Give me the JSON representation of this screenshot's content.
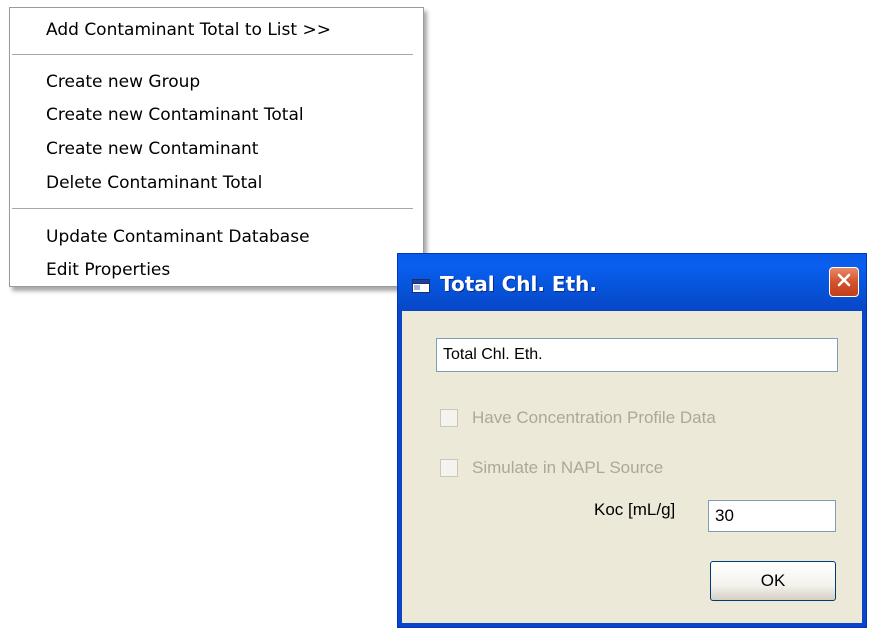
{
  "context_menu": {
    "items": [
      {
        "label": "Add Contaminant Total to List >>"
      },
      {
        "label": "Create new Group"
      },
      {
        "label": "Create new Contaminant Total"
      },
      {
        "label": "Create new Contaminant"
      },
      {
        "label": "Delete Contaminant Total"
      },
      {
        "label": "Update Contaminant Database"
      },
      {
        "label": "Edit Properties"
      }
    ]
  },
  "dialog": {
    "title": "Total Chl. Eth.",
    "title_icon": "window-icon",
    "close_icon": "close-icon",
    "name_value": "Total Chl. Eth.",
    "checkbox_concentration": {
      "label": "Have Concentration Profile Data",
      "checked": false,
      "enabled": false
    },
    "checkbox_napl": {
      "label": "Simulate in NAPL Source",
      "checked": false,
      "enabled": false
    },
    "koc_label": "Koc [mL/g]",
    "koc_value": "30",
    "ok_label": "OK"
  },
  "colors": {
    "titlebar": "#0a5be6",
    "close_button": "#d2522d",
    "dialog_background": "#ece9d8",
    "disabled_text": "#aca899"
  }
}
